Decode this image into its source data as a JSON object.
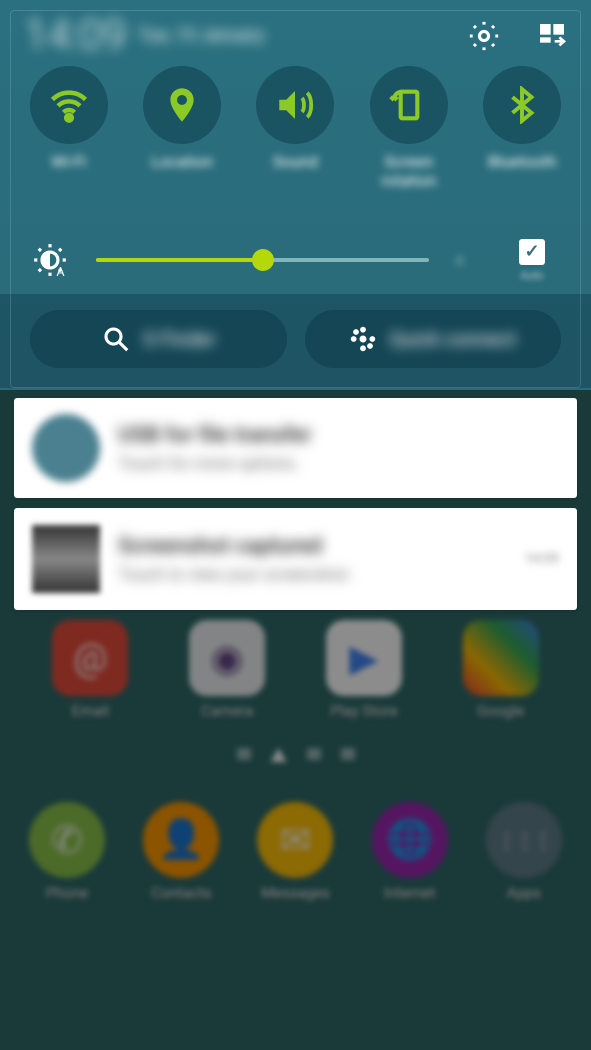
{
  "header": {
    "time": "14:09",
    "date": "Tue, 19 January",
    "settings_icon": "gear",
    "edit_icon": "grid-edit"
  },
  "quick_toggles": [
    {
      "id": "wifi",
      "label": "Wi-Fi",
      "icon": "wifi"
    },
    {
      "id": "location",
      "label": "Location",
      "icon": "pin"
    },
    {
      "id": "sound",
      "label": "Sound",
      "icon": "speaker"
    },
    {
      "id": "rotation",
      "label": "Screen rotation",
      "icon": "rotate"
    },
    {
      "id": "bluetooth",
      "label": "Bluetooth",
      "icon": "bluetooth"
    }
  ],
  "brightness": {
    "value_pct": 50,
    "auto_checked": true,
    "auto_label": "Auto"
  },
  "pill_buttons": {
    "sfinder": "S Finder",
    "quickconnect": "Quick connect"
  },
  "notifications": [
    {
      "id": "usb",
      "title": "USB for file transfer",
      "subtitle": "Touch for more options.",
      "time": ""
    },
    {
      "id": "screenshot",
      "title": "Screenshot captured",
      "subtitle": "Touch to view your screenshot.",
      "time": "14:09"
    }
  ],
  "home_apps_row1": [
    {
      "id": "email",
      "label": "Email",
      "bg": "#e74c3c",
      "glyph": "@"
    },
    {
      "id": "camera",
      "label": "Camera",
      "bg": "#ecf0f1",
      "glyph": "●"
    },
    {
      "id": "play",
      "label": "Play Store",
      "bg": "#fff",
      "glyph": "▶"
    },
    {
      "id": "google",
      "label": "Google",
      "bg": "#4285F4",
      "glyph": "G"
    }
  ],
  "dock_apps": [
    {
      "id": "phone",
      "label": "Phone",
      "bg": "#8bc34a",
      "glyph": "✆"
    },
    {
      "id": "contacts",
      "label": "Contacts",
      "bg": "#ff9800",
      "glyph": "👤"
    },
    {
      "id": "messages",
      "label": "Messages",
      "bg": "#ffc107",
      "glyph": "✉"
    },
    {
      "id": "internet",
      "label": "Internet",
      "bg": "#9c27b0",
      "glyph": "🌐"
    },
    {
      "id": "apps",
      "label": "Apps",
      "bg": "#607d8b",
      "glyph": "⋮⋮⋮"
    }
  ],
  "page_indicator": {
    "count": 4,
    "active": 1
  }
}
